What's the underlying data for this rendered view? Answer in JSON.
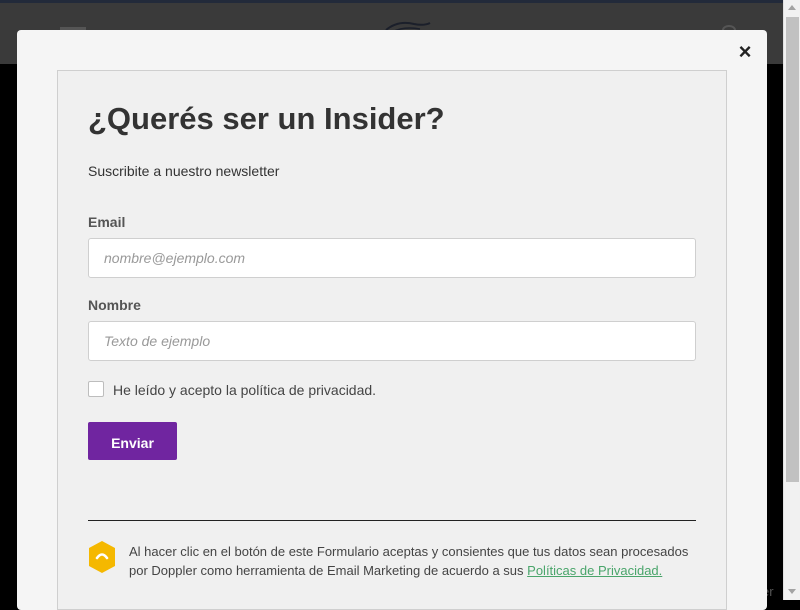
{
  "modal": {
    "close_label": "×",
    "title": "¿Querés ser un Insider?",
    "subtitle": "Suscribite a nuestro newsletter",
    "email": {
      "label": "Email",
      "placeholder": "nombre@ejemplo.com",
      "value": ""
    },
    "name": {
      "label": "Nombre",
      "placeholder": "Texto de ejemplo",
      "value": ""
    },
    "consent": {
      "label": "He leído y acepto la política de privacidad.",
      "checked": false
    },
    "submit_label": "Enviar",
    "legal": {
      "text": "Al hacer clic en el botón de este Formulario aceptas y consientes que tus datos sean procesados por Doppler como herramienta de Email Marketing de acuerdo a sus ",
      "link_label": "Políticas de Privacidad."
    }
  },
  "background": {
    "footer_fragment": "er"
  },
  "colors": {
    "accent": "#7025a0",
    "link": "#4aa56b",
    "shield": "#f5b800",
    "modal_bg": "#f5f5f5",
    "card_bg": "#f0f0f0"
  },
  "icons": {
    "close": "close-icon",
    "shield": "shield-lock-icon",
    "logo": "logo-icon",
    "menu": "menu-icon",
    "search": "search-icon"
  }
}
